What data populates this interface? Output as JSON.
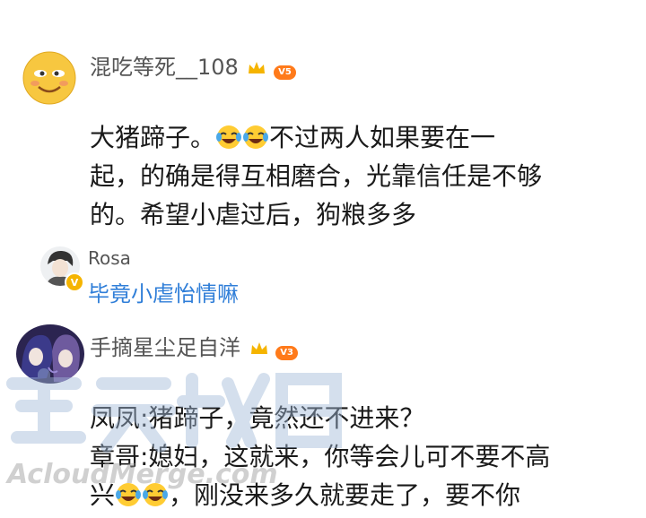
{
  "comments": [
    {
      "username": "混吃等死__108",
      "level": "V5",
      "lines": [
        "大猪蹄子。",
        "不过两人如果要在一",
        "起，的确是得互相磨合，光靠信任是不够",
        "的。希望小虐过后，狗粮多多"
      ],
      "reply": {
        "name": "Rosa",
        "text": "毕竟小虐怡情嘛",
        "verified": "V"
      }
    },
    {
      "username": "手摘星尘足自洋",
      "level": "V3",
      "lines": [
        "凤凤:猪蹄子，竟然还不进来？",
        "章哥:媳妇，这就来，你等会儿可不要不高",
        "兴",
        "，刚没来多久就要走了，要不你"
      ]
    }
  ],
  "icons": {
    "crown": "crown-icon",
    "emoji": "laughing-crying-emoji"
  },
  "watermark": {
    "logo": "AcloudMerge.com"
  },
  "colors": {
    "badge": "#ff7a1a",
    "reply_text": "#2f7ed8",
    "crown": "#f5b400"
  }
}
